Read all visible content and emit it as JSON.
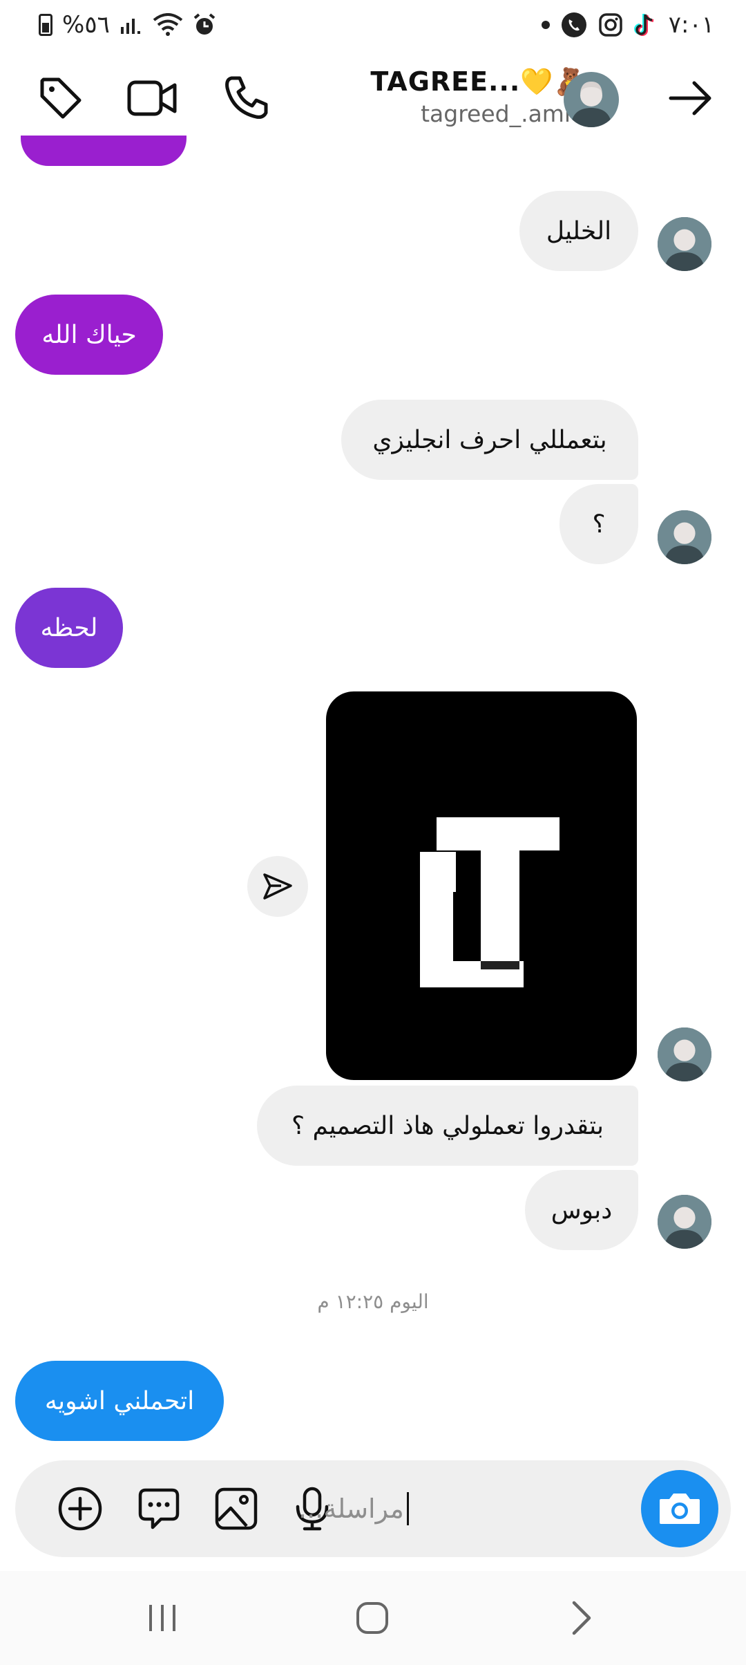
{
  "status": {
    "battery_percent": "%٥٦",
    "time": "٧:٠١"
  },
  "header": {
    "display_name": "TAGREE...💛🧸",
    "username": "tagreed_.amro"
  },
  "messages": [
    {
      "side": "incoming",
      "text": "الخليل"
    },
    {
      "side": "outgoing",
      "text": "حياك الله",
      "color": "#9a1fcf"
    },
    {
      "side": "incoming",
      "text": "بتعمللي احرف انجليزي"
    },
    {
      "side": "incoming",
      "text": "؟"
    },
    {
      "side": "outgoing",
      "text": "لحظه",
      "color": "#7b35d4"
    },
    {
      "side": "incoming",
      "text": "بتقدروا تعملولي هاذ التصميم ؟"
    },
    {
      "side": "incoming",
      "text": "دبوس"
    },
    {
      "side": "outgoing",
      "text": "اتحملني اشويه",
      "color": "#1a8ff0"
    }
  ],
  "image_message": {
    "letters": "LT"
  },
  "timestamp": "اليوم ١٢:٢٥ م",
  "composer": {
    "placeholder": "مراسلة..."
  },
  "colors": {
    "accent_blue": "#1a8ff0",
    "bubble_gray": "#efefef"
  }
}
